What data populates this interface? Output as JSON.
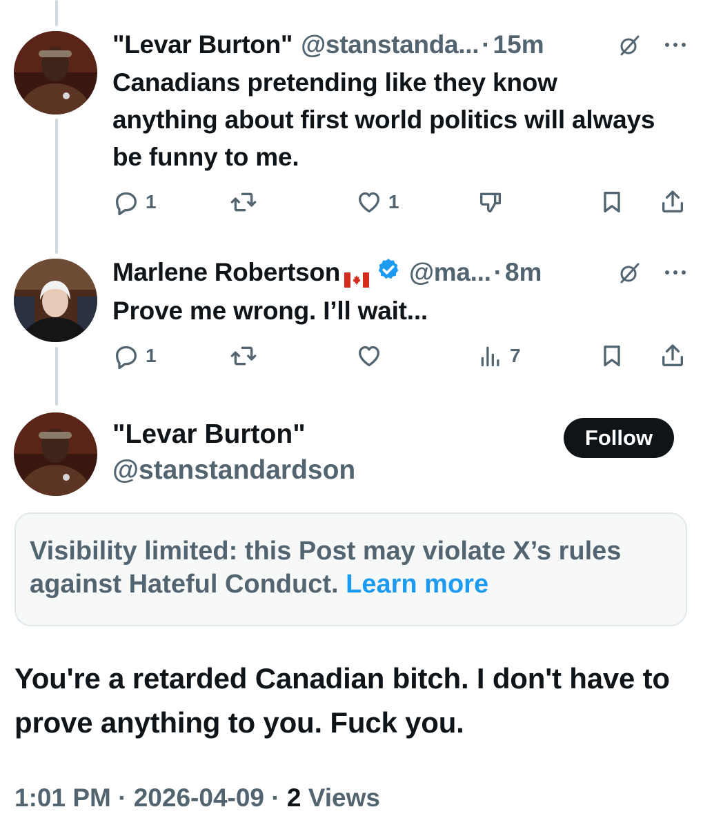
{
  "reply1": {
    "name": "\"Levar Burton\"",
    "handle": "@stanstanda...",
    "separator": "·",
    "time": "15m",
    "text": "Canadians pretending like they know anything about first world politics will always be funny to me.",
    "replies": "1",
    "likes": "1",
    "icons": [
      "reply-icon",
      "repost-icon",
      "like-icon",
      "dislike-icon",
      "bookmark-icon",
      "share-icon"
    ]
  },
  "reply2": {
    "name": "Marlene Robertson",
    "handle": "@ma...",
    "separator": "·",
    "time": "8m",
    "text": "Prove me wrong.  I’ll wait...",
    "replies": "1",
    "views": "7",
    "icons": [
      "reply-icon",
      "repost-icon",
      "like-icon",
      "views-icon",
      "bookmark-icon",
      "share-icon"
    ]
  },
  "main": {
    "name": "\"Levar Burton\"",
    "handle": "@stanstandardson",
    "follow_label": "Follow",
    "notice_text": "Visibility limited: this Post may violate X’s rules against Hateful Conduct.",
    "notice_link": "Learn more",
    "text": "You're a retarded Canadian bitch. I don't have to prove anything to you. Fuck you.",
    "time": "1:01 PM",
    "separator": "·",
    "date": "2026-04-09",
    "views_count": "2",
    "views_label": "Views"
  },
  "colors": {
    "text_primary": "#0f1419",
    "text_secondary": "#536471",
    "link": "#1d9bf0",
    "verified": "#1d9bf0",
    "follow_bg": "#0f1419",
    "thread_line": "#cfd9de"
  }
}
